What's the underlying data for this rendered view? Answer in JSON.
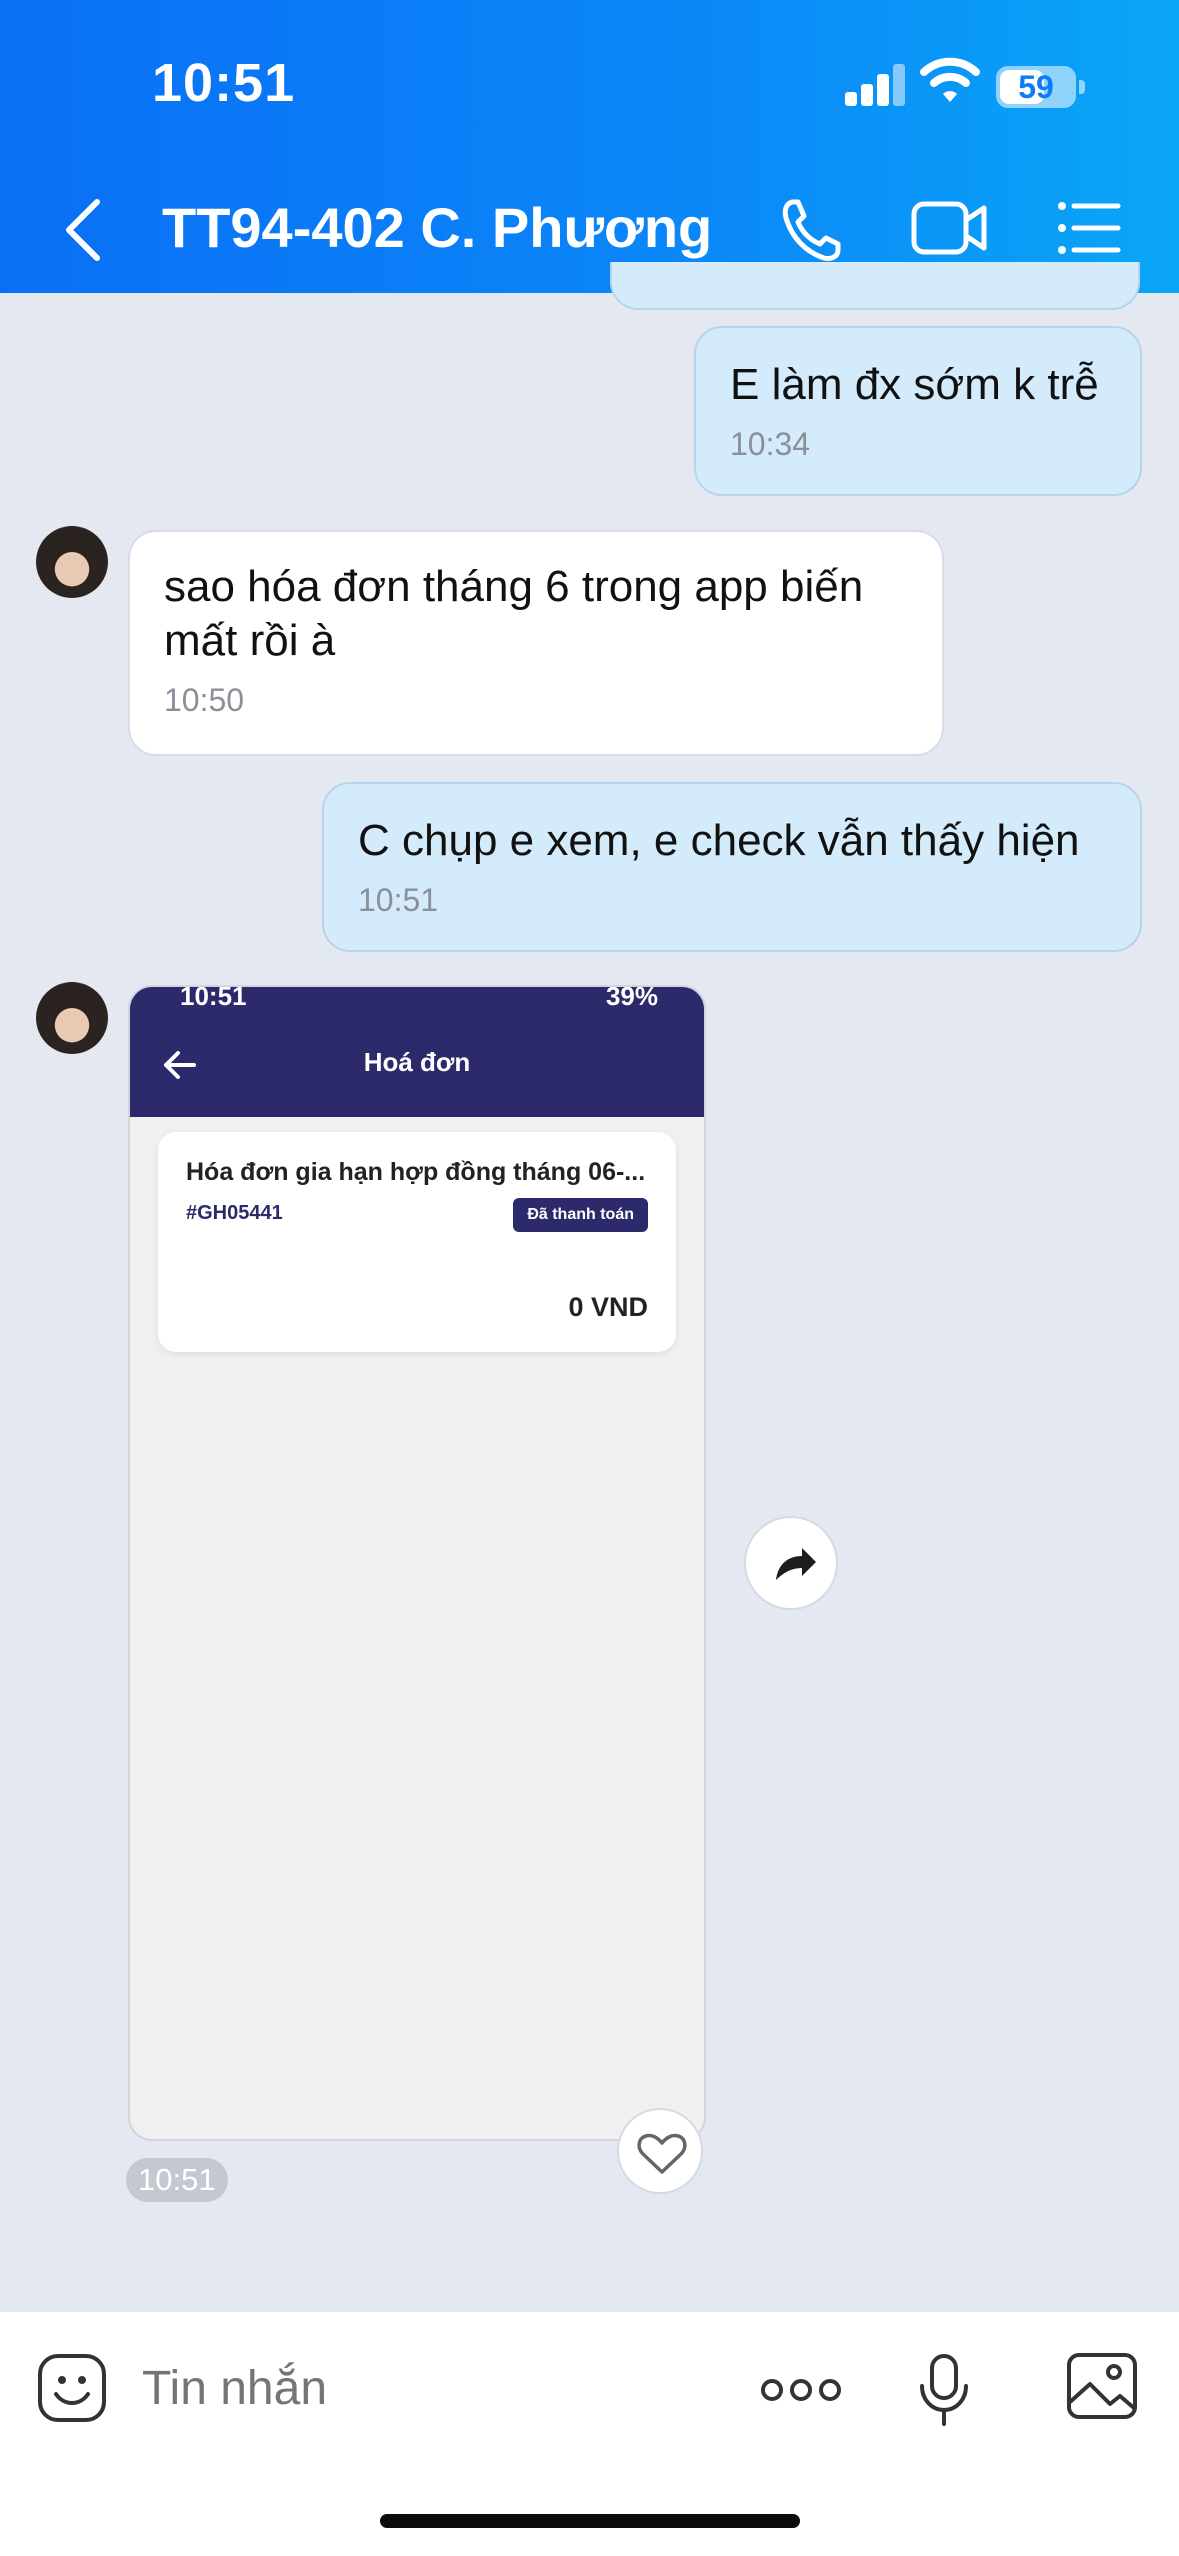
{
  "status_bar": {
    "time": "10:51",
    "battery": "59"
  },
  "header": {
    "title": "TT94-402 C. Phương"
  },
  "messages": [
    {
      "side": "me",
      "text": "E làm đx sớm k trễ",
      "time": "10:34"
    },
    {
      "side": "them",
      "text": "sao hóa đơn tháng 6 trong app biến mất rồi à",
      "time": "10:50"
    },
    {
      "side": "me",
      "text": "C chụp e xem, e check vẫn thấy hiện",
      "time": "10:51"
    }
  ],
  "screenshot": {
    "status_time": "10:51",
    "status_battery": "39%",
    "title": "Hoá đơn",
    "card": {
      "title": "Hóa đơn gia hạn hợp đồng tháng 06-...",
      "code": "#GH05441",
      "status": "Đã thanh toán",
      "amount": "0 VND"
    },
    "time": "10:51"
  },
  "input": {
    "placeholder": "Tin nhắn"
  },
  "colors": {
    "header_start": "#0a6ff5",
    "header_end": "#0aa6f6",
    "my_bubble": "#d3ebfb",
    "invoice_bar": "#2c2a6a"
  }
}
